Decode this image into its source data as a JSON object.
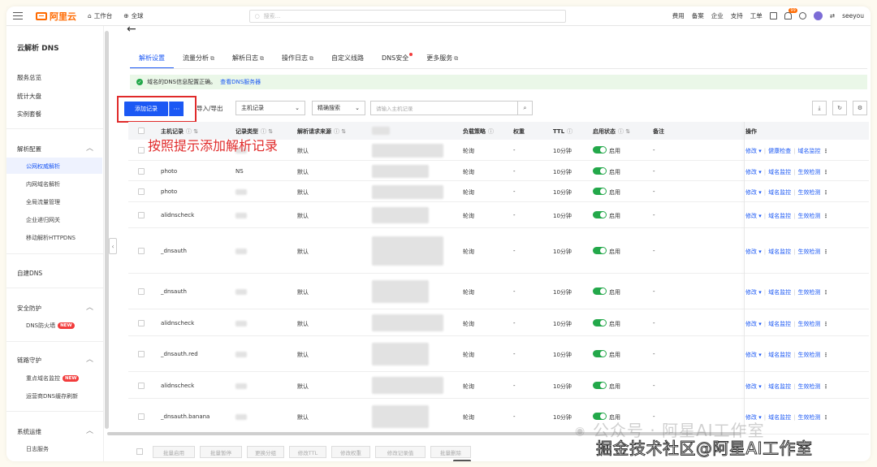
{
  "topbar": {
    "logo": "阿里云",
    "workbench": "工作台",
    "region": "全球",
    "search_placeholder": "搜索...",
    "links": [
      "费用",
      "备案",
      "企业",
      "支持",
      "工单"
    ],
    "bell_count": "99",
    "user": "seeyou"
  },
  "sidebar": {
    "title": "云解析 DNS",
    "items": {
      "overview": "服务总览",
      "stats": "统计大盘",
      "instances": "实例套餐",
      "config": "解析配置",
      "public": "公网权威解析",
      "private": "内网域名解析",
      "gtm": "全局流量管理",
      "gateway": "企业递归网关",
      "httpdns": "移动解析HTTPDNS",
      "selfdns": "自建DNS",
      "security": "安全防护",
      "firewall": "DNS防火墙",
      "link": "链路守护",
      "monitor": "重点域名监控",
      "cache": "运营商DNS缓存刷新",
      "ops": "系统运维",
      "log": "日志服务"
    },
    "new_label": "NEW"
  },
  "tabs": [
    "解析设置",
    "流量分析",
    "解析日志",
    "操作日志",
    "自定义线路",
    "DNS安全",
    "更多服务"
  ],
  "notice": {
    "text": "域名的DNS信息配置正确。",
    "link": "查看DNS服务器"
  },
  "toolbar": {
    "add": "添加记录",
    "more": "···",
    "import": "导入/导出",
    "filter_field": "主机记录",
    "filter_mode": "精确搜索",
    "search_placeholder": "请输入主机记录"
  },
  "annotation": "按照提示添加解析记录",
  "table": {
    "headers": [
      "主机记录",
      "记录类型",
      "解析请求来源",
      "记录值",
      "负载策略",
      "权重",
      "TTL",
      "启用状态",
      "备注",
      "操作"
    ],
    "rows": [
      {
        "host": "",
        "type": "",
        "source": "默认",
        "policy": "轮询",
        "weight": "-",
        "ttl": "10分钟",
        "status": "启用",
        "note": "-",
        "ops": [
          "修改",
          "健康检查",
          "域名监控"
        ]
      },
      {
        "host": "photo",
        "type": "NS",
        "source": "默认",
        "policy": "轮询",
        "weight": "-",
        "ttl": "10分钟",
        "status": "启用",
        "note": "-",
        "ops": [
          "修改",
          "域名监控",
          "生效检测"
        ]
      },
      {
        "host": "photo",
        "type": "",
        "source": "默认",
        "policy": "轮询",
        "weight": "-",
        "ttl": "10分钟",
        "status": "启用",
        "note": "-",
        "ops": [
          "修改",
          "域名监控",
          "生效检测"
        ]
      },
      {
        "host": "alidnscheck",
        "type": "",
        "source": "默认",
        "policy": "轮询",
        "weight": "-",
        "ttl": "10分钟",
        "status": "启用",
        "note": "-",
        "ops": [
          "修改",
          "域名监控",
          "生效检测"
        ]
      },
      {
        "host": "_dnsauth",
        "type": "",
        "source": "默认",
        "policy": "轮询",
        "weight": "-",
        "ttl": "10分钟",
        "status": "启用",
        "note": "-",
        "ops": [
          "修改",
          "域名监控",
          "生效检测"
        ]
      },
      {
        "host": "_dnsauth",
        "type": "",
        "source": "默认",
        "policy": "轮询",
        "weight": "-",
        "ttl": "10分钟",
        "status": "启用",
        "note": "-",
        "ops": [
          "修改",
          "域名监控",
          "生效检测"
        ]
      },
      {
        "host": "alidnscheck",
        "type": "",
        "source": "默认",
        "policy": "轮询",
        "weight": "-",
        "ttl": "10分钟",
        "status": "启用",
        "note": "-",
        "ops": [
          "修改",
          "域名监控",
          "生效检测"
        ]
      },
      {
        "host": "_dnsauth.red",
        "type": "",
        "source": "默认",
        "policy": "轮询",
        "weight": "-",
        "ttl": "10分钟",
        "status": "启用",
        "note": "-",
        "ops": [
          "修改",
          "域名监控",
          "生效检测"
        ]
      },
      {
        "host": "alidnscheck",
        "type": "",
        "source": "默认",
        "policy": "轮询",
        "weight": "-",
        "ttl": "10分钟",
        "status": "启用",
        "note": "-",
        "ops": [
          "修改",
          "域名监控",
          "生效检测"
        ]
      },
      {
        "host": "_dnsauth.banana",
        "type": "",
        "source": "默认",
        "policy": "轮询",
        "weight": "-",
        "ttl": "10分钟",
        "status": "启用",
        "note": "-",
        "ops": [
          "修改",
          "域名监控",
          "生效检测"
        ]
      }
    ]
  },
  "footer": {
    "buttons": [
      "批量启用",
      "批量暂停",
      "更换分组",
      "修改TTL",
      "修改权重",
      "修改记录值",
      "批量删除"
    ]
  },
  "watermark": {
    "line1": "公众号 · 阿星AI工作室",
    "line2": "掘金技术社区@阿星AI工作室"
  },
  "colors": {
    "primary": "#1b58f4",
    "accent": "#ff6a00",
    "alert": "#e02a2a",
    "success": "#23a84a"
  }
}
